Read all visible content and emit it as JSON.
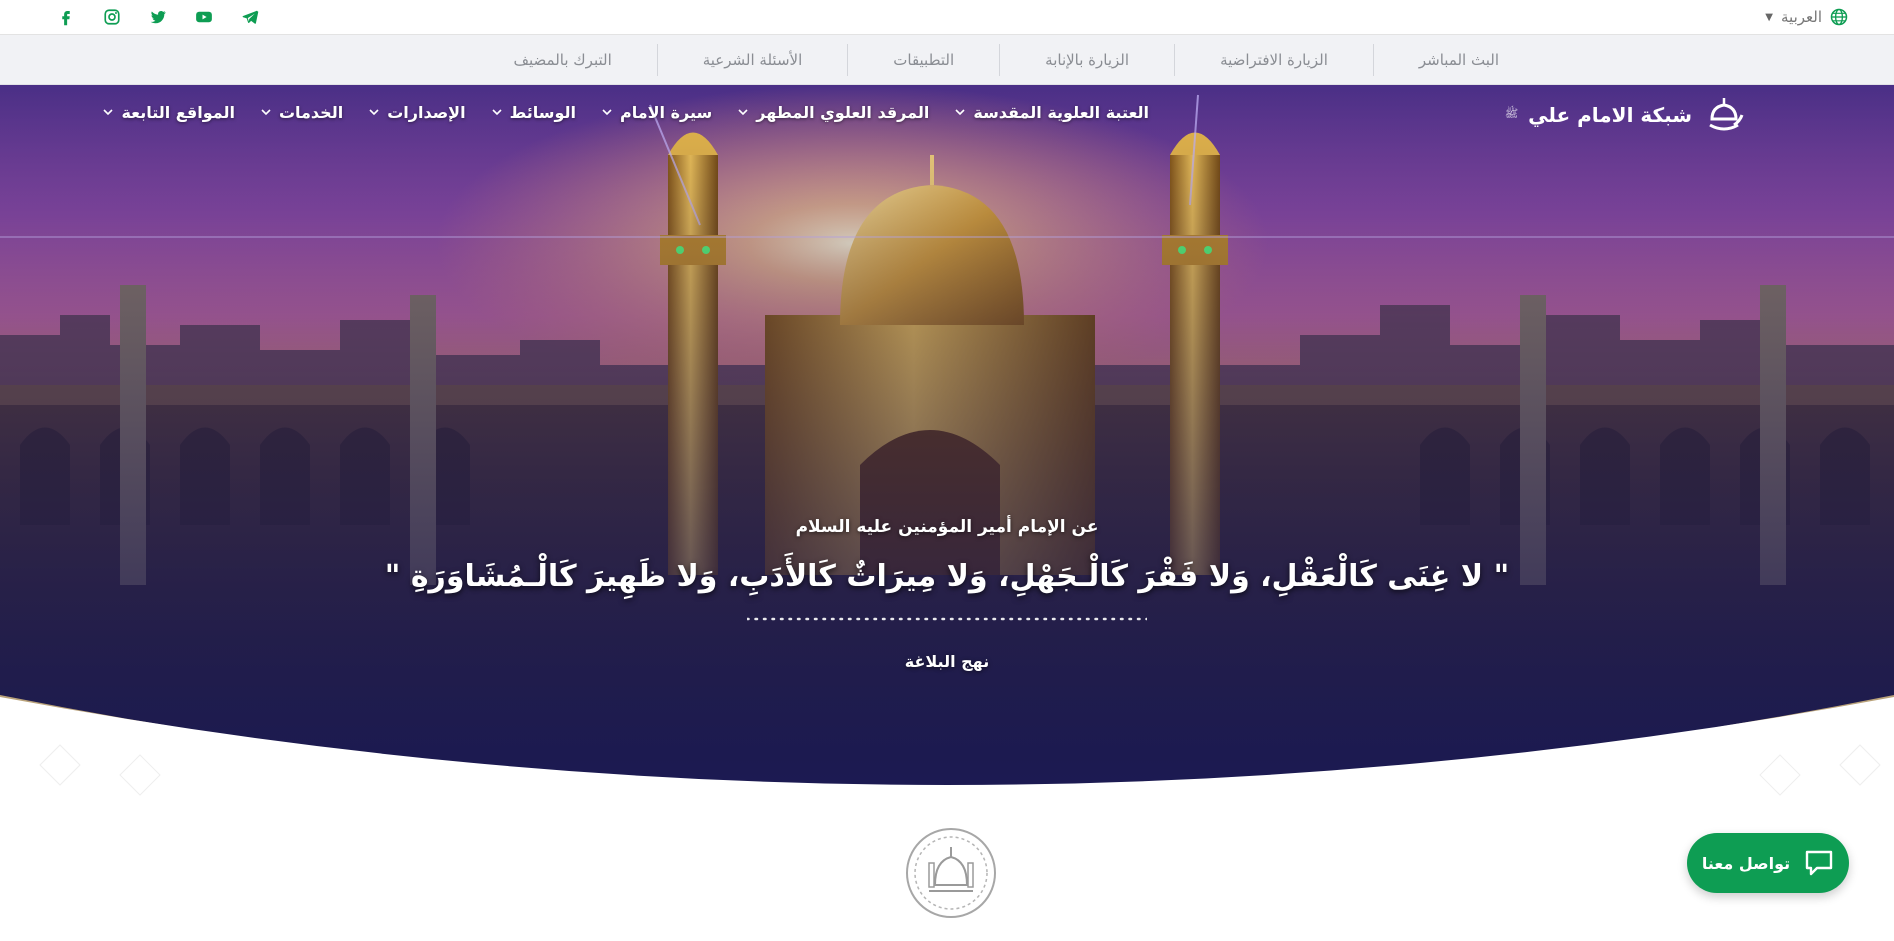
{
  "colors": {
    "brand_green": "#0e9d53",
    "subnav_bg": "#f1f2f5",
    "gold": "#b9a27a"
  },
  "topbar": {
    "language": "العربية",
    "socials": [
      "telegram-icon",
      "youtube-icon",
      "twitter-icon",
      "instagram-icon",
      "facebook-icon"
    ]
  },
  "subnav": {
    "items": [
      "البث المباشر",
      "الزيارة الافتراضية",
      "الزيارة بالإنابة",
      "التطبيقات",
      "الأسئلة الشرعية",
      "التبرك بالمضيف"
    ]
  },
  "brand": {
    "name": "شبكة الامام علي",
    "honorific": "ﷺ"
  },
  "mainnav": {
    "items": [
      "العتبة العلوية المقدسة",
      "المرقد العلوي المطهر",
      "سيرة الامام",
      "الوسائط",
      "الإصدارات",
      "الخدمات",
      "المواقع التابعة"
    ]
  },
  "hero": {
    "attribution": "عن الإمام أمير المؤمنين عليه السلام",
    "quote": "\" لا غِنَى كَالْعَقْلِ، وَلا فَقْرَ كَالْـجَهْلِ، وَلا مِيرَاثٌ كَالأَدَبِ، وَلا ظَهِيرَ كَالْـمُشَاوَرَةِ \"",
    "source": "نهج البلاغة"
  },
  "contact": {
    "label": "تواصل معنا"
  }
}
